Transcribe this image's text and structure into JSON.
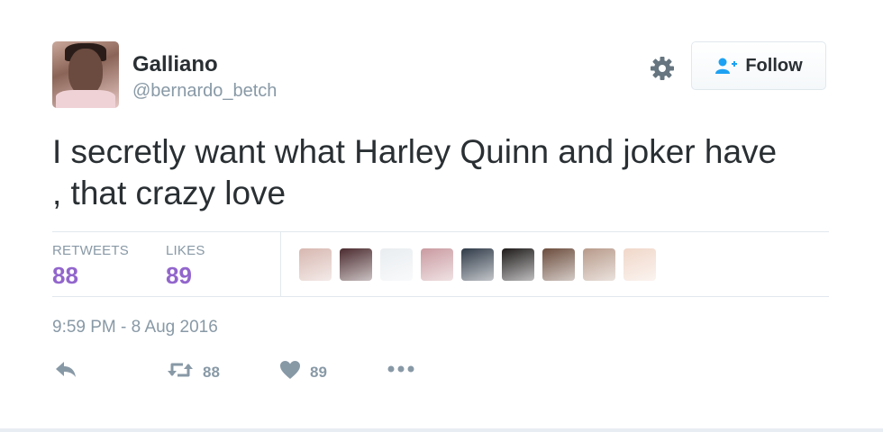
{
  "user": {
    "name": "Galliano",
    "handle": "@bernardo_betch"
  },
  "follow_button": {
    "label": "Follow"
  },
  "tweet": {
    "text_line1": "I secretly want what Harley Quinn and joker have",
    "text_line2": ", that crazy love",
    "timestamp": "9:59 PM - 8 Aug 2016"
  },
  "stats": {
    "retweets_label": "RETWEETS",
    "retweets_count": "88",
    "likes_label": "LIKES",
    "likes_count": "89"
  },
  "actions": {
    "retweet_count": "88",
    "like_count": "89"
  },
  "likers": [
    {
      "icon": "liker-avatar-1",
      "color": "#d7b7b0"
    },
    {
      "icon": "liker-avatar-2",
      "color": "#4a2a2e"
    },
    {
      "icon": "liker-avatar-3",
      "color": "#e9edf0"
    },
    {
      "icon": "liker-avatar-4",
      "color": "#c99aa0"
    },
    {
      "icon": "liker-avatar-5",
      "color": "#2f3a48"
    },
    {
      "icon": "liker-avatar-6",
      "color": "#1e1a1a"
    },
    {
      "icon": "liker-avatar-7",
      "color": "#6b4c3c"
    },
    {
      "icon": "liker-avatar-8",
      "color": "#b79a8a"
    },
    {
      "icon": "liker-avatar-9",
      "color": "#f0d7c9"
    }
  ],
  "colors": {
    "stat_value": "#9266cc",
    "muted": "#8899a6",
    "text": "#292f33",
    "accent": "#1da1f2"
  }
}
